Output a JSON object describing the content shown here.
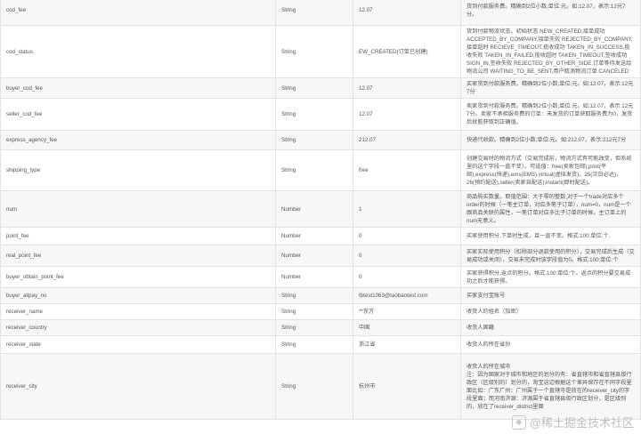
{
  "rows": [
    {
      "name": "cod_fee",
      "type": "String",
      "example": "12.07",
      "desc": "货到付款服务费。精确到2位小数;单位:元。如:12.07，表示:12元7分。"
    },
    {
      "name": "cod_status",
      "type": "String",
      "example": "EW_CREATED(订单已创建)",
      "desc": "货到付款物流状态。初始状态 NEW_CREATED,接单成功 ACCEPTED_BY_COMPANY,接单失败 REJECTED_BY_COMPANY,接单超时 RECIEVE_TIMEOUT,揽收成功 TAKEN_IN_SUCCESS,揽收失败 TAKEN_IN_FAILED,揽收超时 TAKEN_TIMEOUT,签收成功 SIGN_IN,签收失败 REJECTED_BY_OTHER_SIDE,订单等待发送给物流公司 WAITING_TO_BE_SENT,用户取消物流订单 CANCELED"
    },
    {
      "name": "buyer_cod_fee",
      "type": "String",
      "example": "12.07",
      "desc": "买家货到付款服务费。精确到2位小数;单位:元。如:12.07，表示:12元7分"
    },
    {
      "name": "seller_cod_fee",
      "type": "String",
      "example": "12.07",
      "desc": "卖家货到付款服务费。精确到2位小数;单位:元。如:12.07，表示:12元7分。卖家不承担服务费的订单：未发货的订单获取服务费为0，发货后就能获取到正确值。"
    },
    {
      "name": "express_agency_fee",
      "type": "String",
      "example": "212.07",
      "desc": "快递代收款。精确到2位小数;单位:元。如:212.07，表示:212元7分"
    },
    {
      "name": "shipping_type",
      "type": "String",
      "example": "free",
      "desc": "创建交易时的物流方式（交易完成前，物流方式有可能改变，但系统里的这个字段一直不变）。可选值：free(卖家包邮),post(平邮),express(快递),ems(EMS),virtual(虚拟发货)，25(次日必达)，26(预约配送),seller(卖家自配送),instant(即时配送)。"
    },
    {
      "name": "num",
      "type": "Number",
      "example": "1",
      "desc": "商品购买数量。取值范围：大于零的整数,对于一个trade对应多个order的时候（一笔主订单，对应多笔子订单），num=0，num是一个跟商品关联的属性，一笔订单对应多比子订单的时候，主订单上的num无意义。"
    },
    {
      "name": "point_fee",
      "type": "Number",
      "example": "0",
      "desc": "买家使用积分,下单时生成，且一直不变。格式:100;单位:个."
    },
    {
      "name": "real_point_fee",
      "type": "Number",
      "example": "0",
      "desc": "买家实际使用积分（扣除部分退款使用的积分），交易完成后生成（交易成功或关闭），交易未完成时该字段值为0。格式:100;单位:个"
    },
    {
      "name": "buyer_obtain_point_fee",
      "type": "Number",
      "example": "0",
      "desc": "买家获得积分,返点的积分。格式:100;单位:个。返点的积分要交易成功之后才能获得。"
    },
    {
      "name": "buyer_alipay_no",
      "type": "String",
      "example": "tbtest1063@taobaotest.com",
      "desc": "买家支付宝账号"
    },
    {
      "name": "receiver_name",
      "type": "String",
      "example": "**东方",
      "desc": "收货人的姓名（加密）"
    },
    {
      "name": "receiver_country",
      "type": "String",
      "example": "中国",
      "desc": "收货人国籍"
    },
    {
      "name": "receiver_state",
      "type": "String",
      "example": "浙江省",
      "desc": "收货人的所在省份"
    },
    {
      "name": "receiver_city",
      "type": "String",
      "example": "杭州市",
      "desc": "收货人的所在城市\n注：因为国家对于城市和地区的划分的有：省直辖市和省直辖县级行政区（区级别的）划分的，淘宝这边根据这个差异保存在不同字段里面比如：广东广州：广州属于一个直辖市是放在的receiver_city的字段里面；而河南济源：济源属于省直辖县级行政区划分，是区级别的，放在了receiver_district里面"
    }
  ],
  "watermark": {
    "icon": "juejin-logo-icon",
    "text": "@稀土掘金技术社区"
  }
}
